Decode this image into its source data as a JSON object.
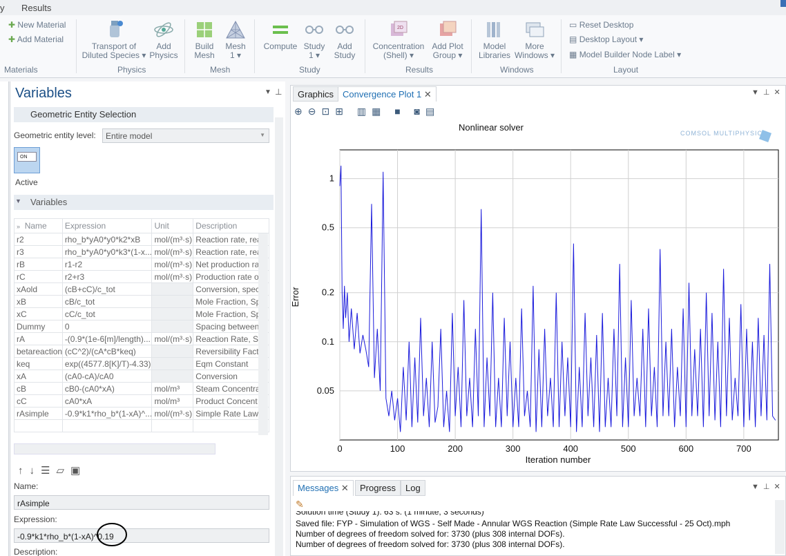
{
  "ribbon_tabs": {
    "first": "y",
    "results": "Results"
  },
  "ribbon": {
    "materials": {
      "new": "New Material",
      "add": "Add Material",
      "group": "Materials"
    },
    "physics": {
      "transport_l1": "Transport of",
      "transport_l2": "Diluted Species ▾",
      "add_physics_l1": "Add",
      "add_physics_l2": "Physics",
      "group": "Physics"
    },
    "mesh": {
      "build_l1": "Build",
      "build_l2": "Mesh",
      "mesh_l1": "Mesh",
      "mesh_l2": "1 ▾",
      "group": "Mesh"
    },
    "study": {
      "compute": "Compute",
      "study_l1": "Study",
      "study_l2": "1 ▾",
      "add_l1": "Add",
      "add_l2": "Study",
      "group": "Study"
    },
    "results": {
      "conc_l1": "Concentration",
      "conc_l2": "(Shell) ▾",
      "addplot_l1": "Add Plot",
      "addplot_l2": "Group ▾",
      "group": "Results"
    },
    "windows": {
      "libs_l1": "Model",
      "libs_l2": "Libraries",
      "more_l1": "More",
      "more_l2": "Windows ▾",
      "group": "Windows"
    },
    "layout": {
      "reset": "Reset Desktop",
      "desktop": "Desktop Layout ▾",
      "node": "Model Builder Node Label ▾",
      "group": "Layout"
    }
  },
  "settings": {
    "title": "Variables",
    "geo_section": "Geometric Entity Selection",
    "geo_level_label": "Geometric entity level:",
    "geo_level_value": "Entire model",
    "active_toggle": "ON",
    "active_label": "Active",
    "var_section": "Variables",
    "columns": [
      "Name",
      "Expression",
      "Unit",
      "Description"
    ],
    "rows": [
      [
        "r2",
        "rho_b*yA0*y0*k2*xB",
        "mol/(m³·s)",
        "Reaction rate, rea"
      ],
      [
        "r3",
        "rho_b*yA0*y0*k3*(1-x...",
        "mol/(m³·s)",
        "Reaction rate, rea"
      ],
      [
        "rB",
        "r1-r2",
        "mol/(m³·s)",
        "Net production ra"
      ],
      [
        "rC",
        "r2+r3",
        "mol/(m³·s)",
        "Production rate o"
      ],
      [
        "xAold",
        "(cB+cC)/c_tot",
        "",
        "Conversion, spec"
      ],
      [
        "xB",
        "cB/c_tot",
        "",
        "Mole Fraction, Sp"
      ],
      [
        "xC",
        "cC/c_tot",
        "",
        "Mole Fraction, Sp"
      ],
      [
        "Dummy",
        "0",
        "",
        "Spacing between"
      ],
      [
        "rA",
        "-(0.9*(1e-6[m]/length)...",
        "mol/(m³·s)",
        "Reaction Rate, Sp"
      ],
      [
        "betareaction",
        "(cC^2)/(cA*cB*keq)",
        "",
        "Reversibility Facto"
      ],
      [
        "keq",
        "exp((4577.8[K]/T)-4.33)",
        "",
        "Eqm Constant"
      ],
      [
        "xA",
        "(cA0-cA)/cA0",
        "",
        "Conversion"
      ],
      [
        "cB",
        "cB0-(cA0*xA)",
        "mol/m³",
        "Steam Concentra"
      ],
      [
        "cC",
        "cA0*xA",
        "mol/m³",
        "Product Concent"
      ],
      [
        "rAsimple",
        "-0.9*k1*rho_b*(1-xA)^...",
        "mol/(m³·s)",
        "Simple Rate Law"
      ]
    ],
    "name_label": "Name:",
    "name_value": "rAsimple",
    "expr_label": "Expression:",
    "expr_value": "-0.9*k1*rho_b*(1-xA)^0.19",
    "desc_label": "Description:"
  },
  "plot_tabs": {
    "graphics": "Graphics",
    "convergence": "Convergence Plot 1"
  },
  "chart_data": {
    "type": "line",
    "title": "Nonlinear solver",
    "xlabel": "Iteration number",
    "ylabel": "Error",
    "xlim": [
      0,
      760
    ],
    "ylim": [
      0.025,
      1.5
    ],
    "yscale": "log",
    "xticks": [
      0,
      100,
      200,
      300,
      400,
      500,
      600,
      700
    ],
    "yticks": [
      0.05,
      0.1,
      0.2,
      0.5,
      1
    ],
    "grid": true,
    "color": "#1a1adb",
    "brand": "COMSOL MULTIPHYSICS",
    "series": [
      {
        "x": [
          0,
          2,
          4,
          6,
          8,
          10,
          13,
          16,
          20,
          25,
          30,
          35,
          40,
          45,
          50,
          55,
          60,
          65,
          70,
          75,
          80,
          85,
          90,
          95,
          100,
          105,
          110,
          115,
          120,
          125,
          130,
          135,
          140,
          145,
          150,
          155,
          160,
          165,
          170,
          175,
          180,
          185,
          190,
          195,
          200,
          205,
          210,
          215,
          220,
          225,
          230,
          235,
          240,
          245,
          250,
          255,
          260,
          265,
          270,
          275,
          280,
          285,
          290,
          295,
          300,
          305,
          310,
          315,
          320,
          325,
          330,
          335,
          340,
          345,
          350,
          355,
          360,
          365,
          370,
          375,
          380,
          385,
          390,
          395,
          400,
          405,
          410,
          415,
          420,
          425,
          430,
          435,
          440,
          445,
          450,
          455,
          460,
          465,
          470,
          475,
          480,
          485,
          490,
          495,
          500,
          505,
          510,
          515,
          520,
          525,
          530,
          535,
          540,
          545,
          550,
          555,
          560,
          565,
          570,
          575,
          580,
          585,
          590,
          595,
          600,
          605,
          610,
          615,
          620,
          625,
          630,
          635,
          640,
          645,
          650,
          655,
          660,
          665,
          670,
          675,
          680,
          685,
          690,
          695,
          700,
          705,
          710,
          715,
          720,
          725,
          730,
          735,
          740,
          745,
          750,
          755
        ],
        "values": [
          0.9,
          1.2,
          0.2,
          0.12,
          0.22,
          0.14,
          0.2,
          0.1,
          0.16,
          0.09,
          0.15,
          0.085,
          0.11,
          0.09,
          0.07,
          0.7,
          0.06,
          0.12,
          0.05,
          1.1,
          0.045,
          0.035,
          0.05,
          0.033,
          0.045,
          0.028,
          0.07,
          0.033,
          0.1,
          0.03,
          0.08,
          0.032,
          0.14,
          0.035,
          0.06,
          0.03,
          0.1,
          0.032,
          0.04,
          0.12,
          0.03,
          0.05,
          0.028,
          0.15,
          0.035,
          0.07,
          0.03,
          0.18,
          0.035,
          0.06,
          0.03,
          0.12,
          0.035,
          0.65,
          0.03,
          0.08,
          0.035,
          0.2,
          0.03,
          0.06,
          0.03,
          0.14,
          0.035,
          0.1,
          0.03,
          0.06,
          0.03,
          0.16,
          0.035,
          0.05,
          0.03,
          0.22,
          0.028,
          0.09,
          0.03,
          0.12,
          0.035,
          0.06,
          0.03,
          0.2,
          0.03,
          0.1,
          0.035,
          0.08,
          0.03,
          0.4,
          0.028,
          0.07,
          0.03,
          0.15,
          0.035,
          0.08,
          0.03,
          0.11,
          0.028,
          0.15,
          0.03,
          0.06,
          0.03,
          0.12,
          0.035,
          0.3,
          0.03,
          0.08,
          0.03,
          0.18,
          0.035,
          0.06,
          0.035,
          0.12,
          0.03,
          0.16,
          0.035,
          0.07,
          0.03,
          0.37,
          0.035,
          0.1,
          0.035,
          0.12,
          0.03,
          0.07,
          0.035,
          0.16,
          0.03,
          0.23,
          0.035,
          0.09,
          0.035,
          0.12,
          0.03,
          0.2,
          0.035,
          0.15,
          0.033,
          0.1,
          0.03,
          0.28,
          0.035,
          0.14,
          0.033,
          0.06,
          0.035,
          0.17,
          0.03,
          0.12,
          0.033,
          0.1,
          0.03,
          0.14,
          0.035,
          0.11,
          0.033,
          0.3,
          0.035,
          0.033
        ]
      }
    ]
  },
  "messages": {
    "tabs": [
      "Messages",
      "Progress",
      "Log"
    ],
    "lines": [
      "Solution time (Study 1): 63 s. (1 minute, 3 seconds)",
      "Saved file: FYP - Simulation of WGS - Self Made - Annular WGS Reaction (Simple Rate Law Successful - 25 Oct).mph",
      "Number of degrees of freedom solved for: 3730 (plus 308 internal DOFs).",
      "Number of degrees of freedom solved for: 3730 (plus 308 internal DOFs)."
    ]
  }
}
